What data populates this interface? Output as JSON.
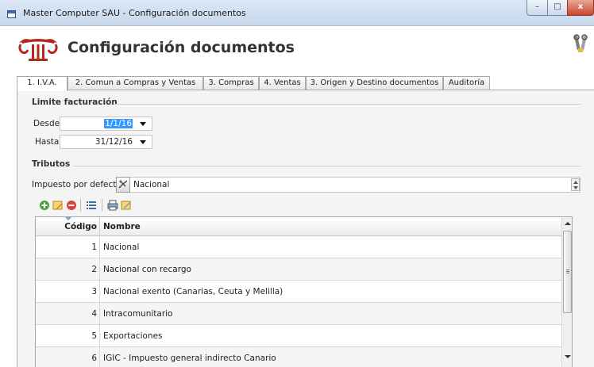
{
  "window": {
    "title": "Master Computer SAU - Configuración documentos",
    "minimize_glyph": "–",
    "maximize_glyph": "□",
    "close_glyph": "x"
  },
  "header": {
    "title": "Configuración documentos",
    "logo_icon": "greek-column-logo",
    "tool_icon": "tools-wrench-icon"
  },
  "tabs": [
    {
      "label": "1. I.V.A.",
      "active": true
    },
    {
      "label": "2. Comun a Compras y Ventas",
      "active": false
    },
    {
      "label": "3. Compras",
      "active": false
    },
    {
      "label": "4. Ventas",
      "active": false
    },
    {
      "label": "3. Origen y Destino documentos",
      "active": false
    },
    {
      "label": "Auditoría",
      "active": false
    }
  ],
  "limite_facturacion": {
    "title": "Limite facturación",
    "desde_label": "Desde",
    "desde_value": "1/1/16",
    "hasta_label": "Hasta",
    "hasta_value": "31/12/16"
  },
  "tributos": {
    "title": "Tributos",
    "impuesto_label": "Impuesto por defecto",
    "impuesto_value": "Nacional",
    "toolbar_icons": [
      "add-icon",
      "edit-icon",
      "delete-icon",
      "list-icon",
      "print-icon",
      "notes-icon"
    ],
    "columns": {
      "code": "Código",
      "name": "Nombre"
    },
    "rows": [
      {
        "code": "1",
        "name": "Nacional"
      },
      {
        "code": "2",
        "name": "Nacional con recargo"
      },
      {
        "code": "3",
        "name": "Nacional exento (Canarias, Ceuta y Melilla)"
      },
      {
        "code": "4",
        "name": "Intracomunitario"
      },
      {
        "code": "5",
        "name": "Exportaciones"
      },
      {
        "code": "6",
        "name": "IGIC - Impuesto general indirecto Canario"
      }
    ]
  },
  "colors": {
    "accent": "#3399ff",
    "logo_red": "#b22a1c",
    "close_red": "#c9452b"
  }
}
